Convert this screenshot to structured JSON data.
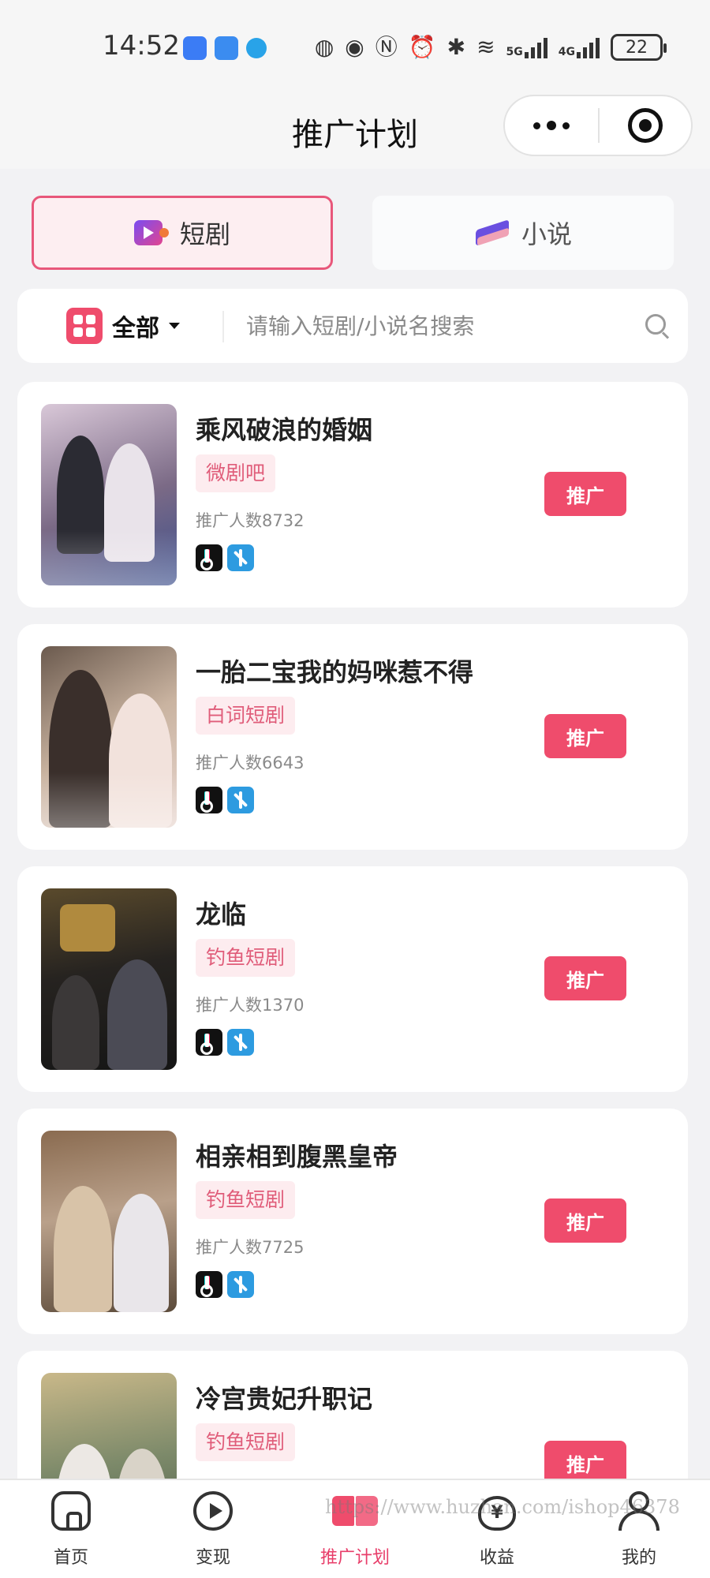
{
  "status_bar": {
    "time": "14:52",
    "network_5g": "5G",
    "network_4g": "4G",
    "battery": "22"
  },
  "header": {
    "title": "推广计划"
  },
  "category_tabs": [
    {
      "label": "短剧",
      "icon": "video-icon",
      "active": true
    },
    {
      "label": "小说",
      "icon": "book-icon",
      "active": false
    }
  ],
  "search": {
    "filter_label": "全部",
    "placeholder": "请输入短剧/小说名搜索",
    "value": ""
  },
  "dramas": [
    {
      "title": "乘风破浪的婚姻",
      "source": "微剧吧",
      "promo_count": "推广人数8732",
      "button": "推广",
      "platforms": [
        "douyin",
        "kuaishou"
      ]
    },
    {
      "title": "一胎二宝我的妈咪惹不得",
      "source": "白词短剧",
      "promo_count": "推广人数6643",
      "button": "推广",
      "platforms": [
        "douyin",
        "kuaishou"
      ]
    },
    {
      "title": "龙临",
      "source": "钓鱼短剧",
      "promo_count": "推广人数1370",
      "button": "推广",
      "platforms": [
        "douyin",
        "kuaishou"
      ]
    },
    {
      "title": "相亲相到腹黑皇帝",
      "source": "钓鱼短剧",
      "promo_count": "推广人数7725",
      "button": "推广",
      "platforms": [
        "douyin",
        "kuaishou"
      ]
    },
    {
      "title": "冷宫贵妃升职记",
      "source": "钓鱼短剧",
      "promo_count": "",
      "button": "推广",
      "platforms": []
    }
  ],
  "tabbar": [
    {
      "label": "首页",
      "icon": "home-icon",
      "active": false
    },
    {
      "label": "变现",
      "icon": "play-icon",
      "active": false
    },
    {
      "label": "推广计划",
      "icon": "book-icon",
      "active": true
    },
    {
      "label": "收益",
      "icon": "money-bag-icon",
      "active": false
    },
    {
      "label": "我的",
      "icon": "user-icon",
      "active": false
    }
  ],
  "watermark": "https://www.huzhan.com/ishop46378",
  "colors": {
    "accent": "#ef4c6c",
    "active_tab_text": "#e83e6a",
    "tag_bg": "#fdecef",
    "tag_text": "#e05d7a",
    "page_bg": "#f2f2f4"
  }
}
